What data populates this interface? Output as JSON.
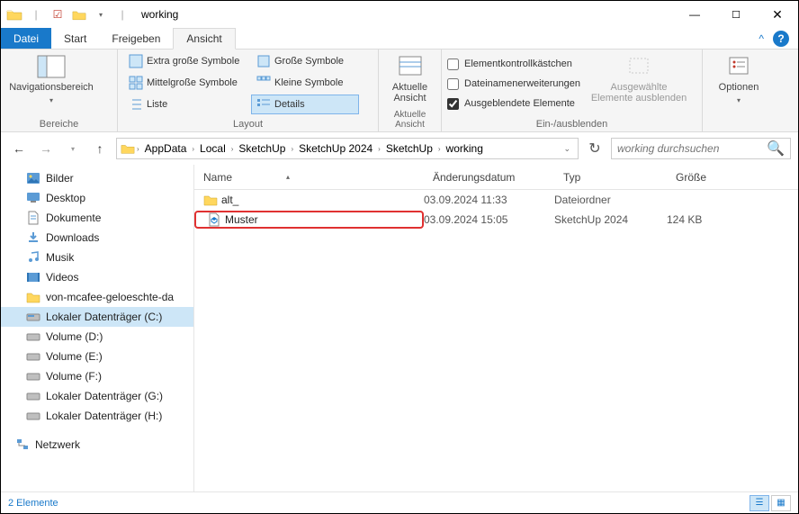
{
  "window": {
    "title": "working"
  },
  "tabs": {
    "file": "Datei",
    "start": "Start",
    "share": "Freigeben",
    "view": "Ansicht"
  },
  "ribbon": {
    "panes_group": "Bereiche",
    "nav_pane": "Navigationsbereich",
    "layout_group": "Layout",
    "layout": {
      "xl": "Extra große Symbole",
      "lg": "Große Symbole",
      "md": "Mittelgroße Symbole",
      "sm": "Kleine Symbole",
      "list": "Liste",
      "details": "Details"
    },
    "current_view_group": "Aktuelle Ansicht",
    "current_view": "Aktuelle\nAnsicht",
    "showhide_group": "Ein-/ausblenden",
    "chk_itemcheck": "Elementkontrollkästchen",
    "chk_ext": "Dateinamenerweiterungen",
    "chk_hidden": "Ausgeblendete Elemente",
    "hide_selected": "Ausgewählte\nElemente ausblenden",
    "options": "Optionen"
  },
  "breadcrumbs": [
    "AppData",
    "Local",
    "SketchUp",
    "SketchUp 2024",
    "SketchUp",
    "working"
  ],
  "search": {
    "placeholder": "working durchsuchen"
  },
  "columns": {
    "name": "Name",
    "modified": "Änderungsdatum",
    "type": "Typ",
    "size": "Größe"
  },
  "rows": [
    {
      "icon": "folder",
      "name": "alt_",
      "modified": "03.09.2024 11:33",
      "type": "Dateiordner",
      "size": ""
    },
    {
      "icon": "skp",
      "name": "Muster",
      "modified": "03.09.2024 15:05",
      "type": "SketchUp 2024",
      "size": "124 KB",
      "highlight": true
    }
  ],
  "tree": [
    {
      "icon": "pictures",
      "label": "Bilder"
    },
    {
      "icon": "desktop",
      "label": "Desktop"
    },
    {
      "icon": "docs",
      "label": "Dokumente"
    },
    {
      "icon": "downloads",
      "label": "Downloads"
    },
    {
      "icon": "music",
      "label": "Musik"
    },
    {
      "icon": "videos",
      "label": "Videos"
    },
    {
      "icon": "folder",
      "label": "von-mcafee-geloeschte-da"
    },
    {
      "icon": "drive-c",
      "label": "Lokaler Datenträger (C:)",
      "selected": true
    },
    {
      "icon": "drive",
      "label": "Volume (D:)"
    },
    {
      "icon": "drive",
      "label": "Volume (E:)"
    },
    {
      "icon": "drive",
      "label": "Volume (F:)"
    },
    {
      "icon": "drive",
      "label": "Lokaler Datenträger (G:)"
    },
    {
      "icon": "drive",
      "label": "Lokaler Datenträger (H:)"
    }
  ],
  "tree_network": "Netzwerk",
  "status": {
    "count": "2 Elemente"
  }
}
